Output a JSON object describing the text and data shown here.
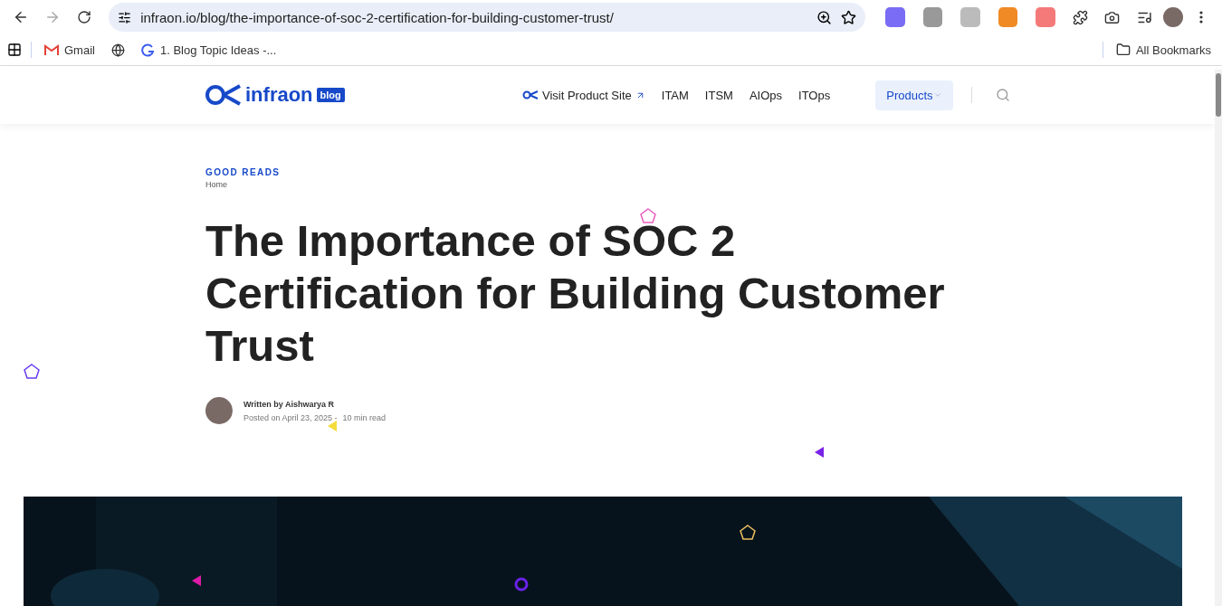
{
  "browser": {
    "url": "infraon.io/blog/the-importance-of-soc-2-certification-for-building-customer-trust/",
    "bookmarks": [
      {
        "kind": "gmail",
        "label": "Gmail"
      },
      {
        "kind": "globe"
      },
      {
        "kind": "g",
        "label": "1. Blog Topic Ideas -..."
      }
    ],
    "all_bookmarks": "All Bookmarks"
  },
  "site": {
    "logo": "infraon",
    "logo_badge": "blog",
    "nav": [
      {
        "label": "Visit Product Site",
        "kind": "external"
      },
      {
        "label": "ITAM",
        "kind": "plain"
      },
      {
        "label": "ITSM",
        "kind": "plain"
      },
      {
        "label": "AIOps",
        "kind": "plain"
      },
      {
        "label": "ITOps",
        "kind": "plain"
      }
    ],
    "products": "Products"
  },
  "article": {
    "category": "GOOD READS",
    "breadcrumb": "Home",
    "title": "The Importance of SOC 2 Certification for Building Customer Trust",
    "author": "Written by Aishwarya R",
    "posted": "Posted on April 23, 2025 -",
    "read_time": "10 min read"
  },
  "confetti": [
    {
      "kind": "pentagon",
      "color": "#e85fc0"
    },
    {
      "kind": "pentagon",
      "color": "#6a3cf0"
    },
    {
      "kind": "triangle",
      "color": "#f5dc3c"
    },
    {
      "kind": "triangle",
      "color": "#7a22e8"
    },
    {
      "kind": "pentagon",
      "color": "#f0c060"
    },
    {
      "kind": "triangle",
      "color": "#e01aa8"
    },
    {
      "kind": "ring",
      "color": "#6a22e8"
    }
  ]
}
